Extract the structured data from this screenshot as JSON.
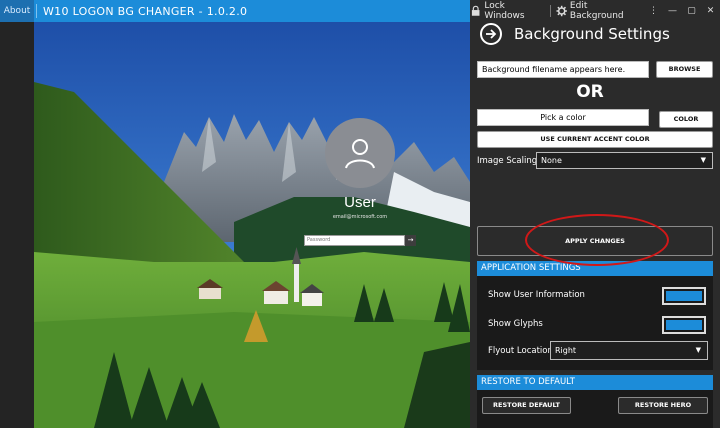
{
  "titlebar": {
    "about": "About",
    "title": "W10 LOGON BG CHANGER - 1.0.2.0"
  },
  "topbar": {
    "lock_icon": "lock-icon",
    "lock_label": "Lock Windows",
    "edit_icon": "gear-icon",
    "edit_label": "Edit Background",
    "more": "⋮",
    "minimize": "—",
    "maximize": "▢",
    "close": "✕"
  },
  "header": {
    "title": "Background Settings",
    "arrow_icon": "arrow-right-circle-icon"
  },
  "background": {
    "filename_value": "Background filename appears here.",
    "browse_label": "BROWSE",
    "or_label": "OR",
    "color_value": "Pick a color",
    "color_label": "COLOR",
    "accent_label": "USE CURRENT ACCENT COLOR",
    "scaling_label": "Image Scaling",
    "scaling_value": "None",
    "apply_label": "APPLY CHANGES"
  },
  "app_settings": {
    "title": "APPLICATION SETTINGS",
    "show_user_info": "Show User Information",
    "show_user_info_on": true,
    "show_glyphs": "Show Glyphs",
    "show_glyphs_on": true,
    "flyout_label": "Flyout Location",
    "flyout_value": "Right"
  },
  "restore": {
    "title": "RESTORE TO DEFAULT",
    "restore_default": "RESTORE DEFAULT",
    "restore_hero": "RESTORE HERO"
  },
  "logon_preview": {
    "username": "User",
    "email": "email@microsoft.com",
    "password_placeholder": "Password"
  },
  "colors": {
    "accent": "#1c8cd9",
    "panel": "#2b2b2b",
    "annotation": "#d01818"
  }
}
